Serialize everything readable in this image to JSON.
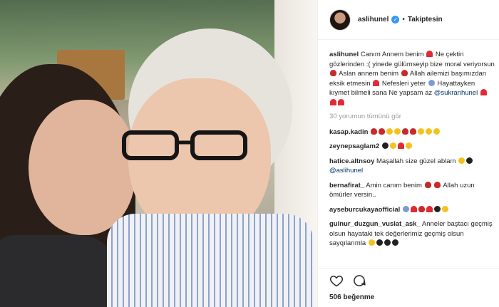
{
  "post": {
    "username": "aslihunel",
    "verified_mark": "✓",
    "dot": "•",
    "follow_status": "Takiptesin"
  },
  "caption": {
    "username": "aslihunel",
    "text1": "Canım Annem benim",
    "text2": "Ne çektin gözlerinden :( yinede gülümseyip bize moral veriyorsun",
    "text3": "Aslan annem benim",
    "text4": "Allah ailemizi başımızdan eksik etmesin",
    "text5": "Nefesleri yeter",
    "text6": "Hayattayken kıymet bilmeli sana Ne yapsam az",
    "mention": "@sukranhunel"
  },
  "view_all_comments": "30 yorumun tümünü gör",
  "comments": [
    {
      "user": "kasap.kadin",
      "text": ""
    },
    {
      "user": "zeynepsaglam2",
      "text": ""
    },
    {
      "user": "hatice.altnsoy",
      "text": "Maşallah size güzel ablam",
      "mention": "@aslihunel"
    },
    {
      "user": "bernafirat_",
      "text": "Amin canım benim",
      "text2": "Allah uzun ömürler versin.."
    },
    {
      "user": "ayseburcukayaofficial",
      "text": ""
    },
    {
      "user": "gulnur_duzgun_vuslat_ask_",
      "text": "Anneler baştacı geçmiş olsun hayataki tek değerlerimiz geçmiş olsun sayqılarımla"
    }
  ],
  "likes_text": "506 beğenme",
  "icons": [
    "heart-icon",
    "comment-icon"
  ],
  "colors": {
    "verified": "#3897f0",
    "heart": "#e02a35",
    "muted": "#999999"
  }
}
